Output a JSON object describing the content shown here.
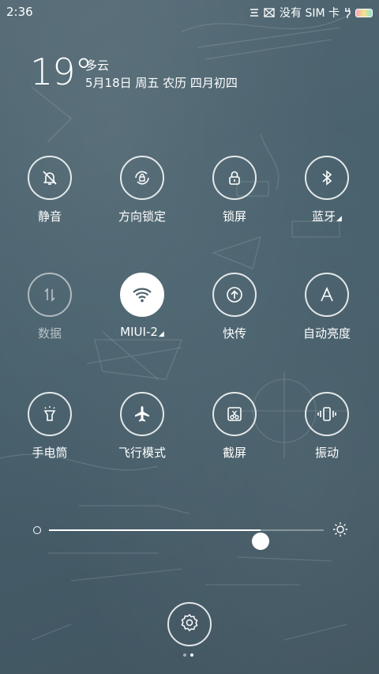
{
  "status_bar": {
    "time": "2:36",
    "sim_text": "没有 SIM 卡",
    "icons": [
      "notification-icon",
      "mail-icon",
      "charging-icon",
      "battery-icon"
    ]
  },
  "weather": {
    "temperature": "19°",
    "condition": "多云",
    "date": "5月18日 周五 农历 四月初四"
  },
  "tiles": [
    {
      "label": "静音",
      "icon": "bell-mute-icon",
      "active": false
    },
    {
      "label": "方向锁定",
      "icon": "rotation-lock-icon",
      "active": false
    },
    {
      "label": "锁屏",
      "icon": "lock-icon",
      "active": false
    },
    {
      "label": "蓝牙",
      "icon": "bluetooth-icon",
      "active": false,
      "has_more": true
    },
    {
      "label": "数据",
      "icon": "mobile-data-icon",
      "active": false,
      "disabled": true
    },
    {
      "label": "MIUI-2",
      "icon": "wifi-icon",
      "active": true,
      "has_more": true
    },
    {
      "label": "快传",
      "icon": "quick-transfer-icon",
      "active": false
    },
    {
      "label": "自动亮度",
      "icon": "auto-brightness-icon",
      "active": false
    },
    {
      "label": "手电筒",
      "icon": "flashlight-icon",
      "active": false
    },
    {
      "label": "飞行模式",
      "icon": "airplane-icon",
      "active": false
    },
    {
      "label": "截屏",
      "icon": "screenshot-icon",
      "active": false
    },
    {
      "label": "振动",
      "icon": "vibrate-icon",
      "active": false
    }
  ],
  "brightness": {
    "level": 0.77
  },
  "settings": {
    "icon": "gear-icon"
  },
  "pager": {
    "pages": 2,
    "current": 1
  },
  "colors": {
    "background": "#4a606b",
    "active_tile": "#ffffff",
    "wifi_icon": "#4a606b"
  }
}
